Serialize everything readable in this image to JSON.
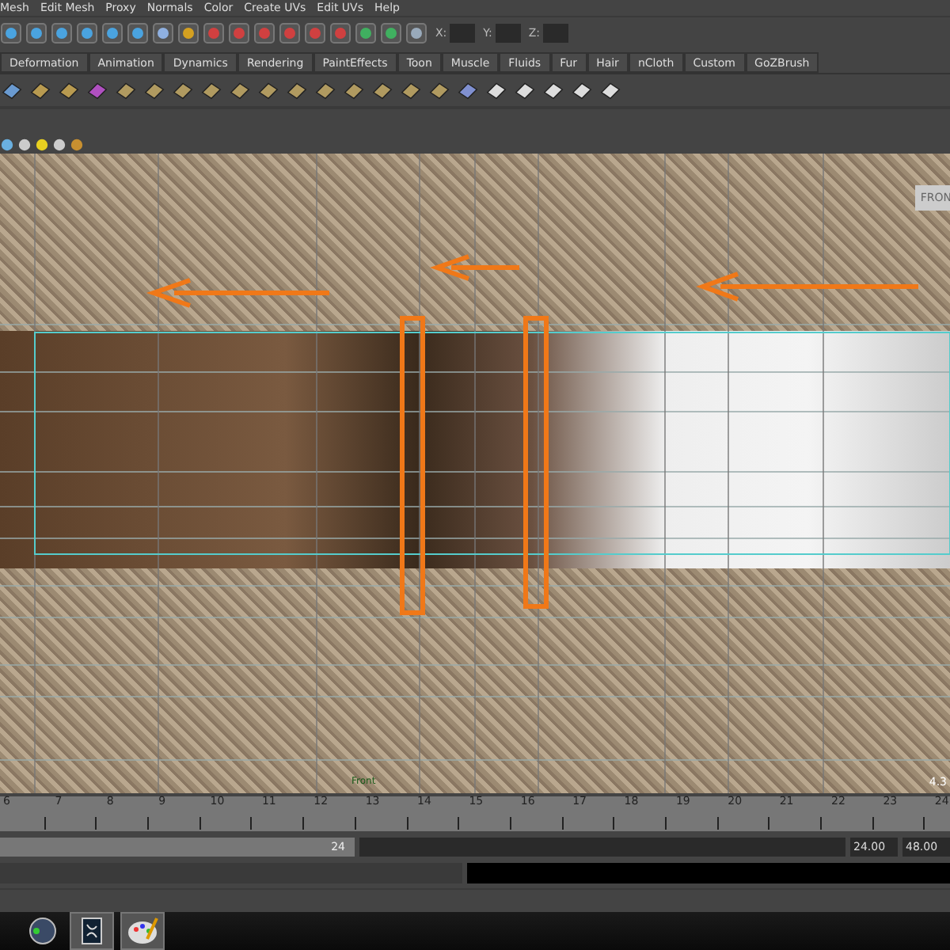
{
  "menu_bar": [
    "Mesh",
    "Edit Mesh",
    "Proxy",
    "Normals",
    "Color",
    "Create UVs",
    "Edit UVs",
    "Help"
  ],
  "status_line": {
    "coordinate_labels": [
      "X:",
      "Y:",
      "Z:"
    ]
  },
  "shelf_tabs": [
    {
      "label": "Deformation",
      "selected": false
    },
    {
      "label": "Animation",
      "selected": false
    },
    {
      "label": "Dynamics",
      "selected": false
    },
    {
      "label": "Rendering",
      "selected": false
    },
    {
      "label": "PaintEffects",
      "selected": false
    },
    {
      "label": "Toon",
      "selected": false
    },
    {
      "label": "Muscle",
      "selected": false
    },
    {
      "label": "Fluids",
      "selected": false
    },
    {
      "label": "Fur",
      "selected": false
    },
    {
      "label": "Hair",
      "selected": false
    },
    {
      "label": "nCloth",
      "selected": false
    },
    {
      "label": "Custom",
      "selected": false
    },
    {
      "label": "GoZBrush",
      "selected": false
    }
  ],
  "viewport": {
    "camera_label": "FRON",
    "camera_name": "Front",
    "frame_rate": "4.3"
  },
  "time_slider": {
    "frames": [
      "6",
      "7",
      "8",
      "9",
      "10",
      "11",
      "12",
      "13",
      "14",
      "15",
      "16",
      "17",
      "18",
      "19",
      "20",
      "21",
      "22",
      "23",
      "24"
    ]
  },
  "range_slider": {
    "range_end": "24",
    "end_time": "24.00",
    "total_end": "48.00"
  }
}
